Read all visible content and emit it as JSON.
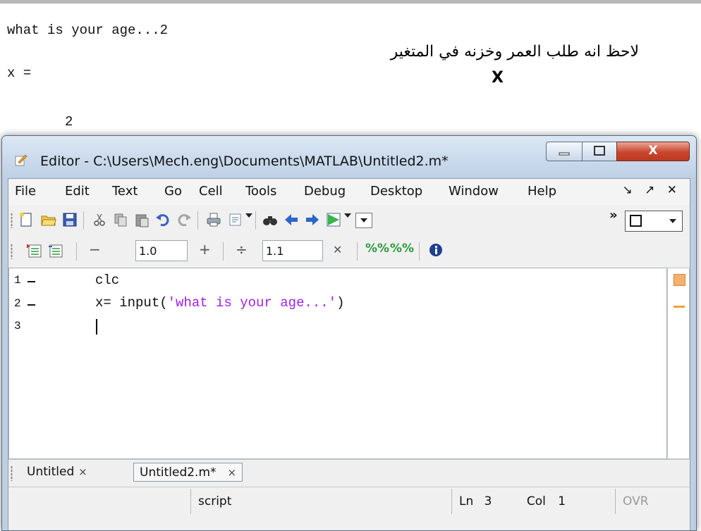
{
  "command_window": {
    "line1": "what is your age...2",
    "line2": "x =",
    "line3": "2"
  },
  "annotation": {
    "arabic": "لاحظ انه طلب العمر وخزنه في المتغير",
    "var": "X"
  },
  "editor": {
    "title": "Editor - C:\\Users\\Mech.eng\\Documents\\MATLAB\\Untitled2.m*",
    "close_label": "X",
    "menu": [
      "File",
      "Edit",
      "Text",
      "Go",
      "Cell",
      "Tools",
      "Debug",
      "Desktop",
      "Window",
      "Help"
    ],
    "menu_right": "↘ ↗ ✕",
    "cell_field_1": "1.0",
    "cell_field_2": "1.1",
    "toolbar_chevron": "»",
    "code_lines": [
      {
        "num": "1",
        "code": "clc"
      },
      {
        "num": "2",
        "code_var": "x=",
        "code_fn": "input(",
        "code_str": "'what is your age...'",
        "code_end": ")"
      },
      {
        "num": "3"
      }
    ],
    "tabs": [
      "Untitled",
      "Untitled2.m*"
    ],
    "status": {
      "type": "script",
      "ln_label": "Ln",
      "ln": "3",
      "col_label": "Col",
      "col": "1",
      "mode": "OVR"
    }
  },
  "colors": {
    "string": "#a020f0",
    "title_bg": "#cbdaeb",
    "close_btn": "#c9452b"
  }
}
